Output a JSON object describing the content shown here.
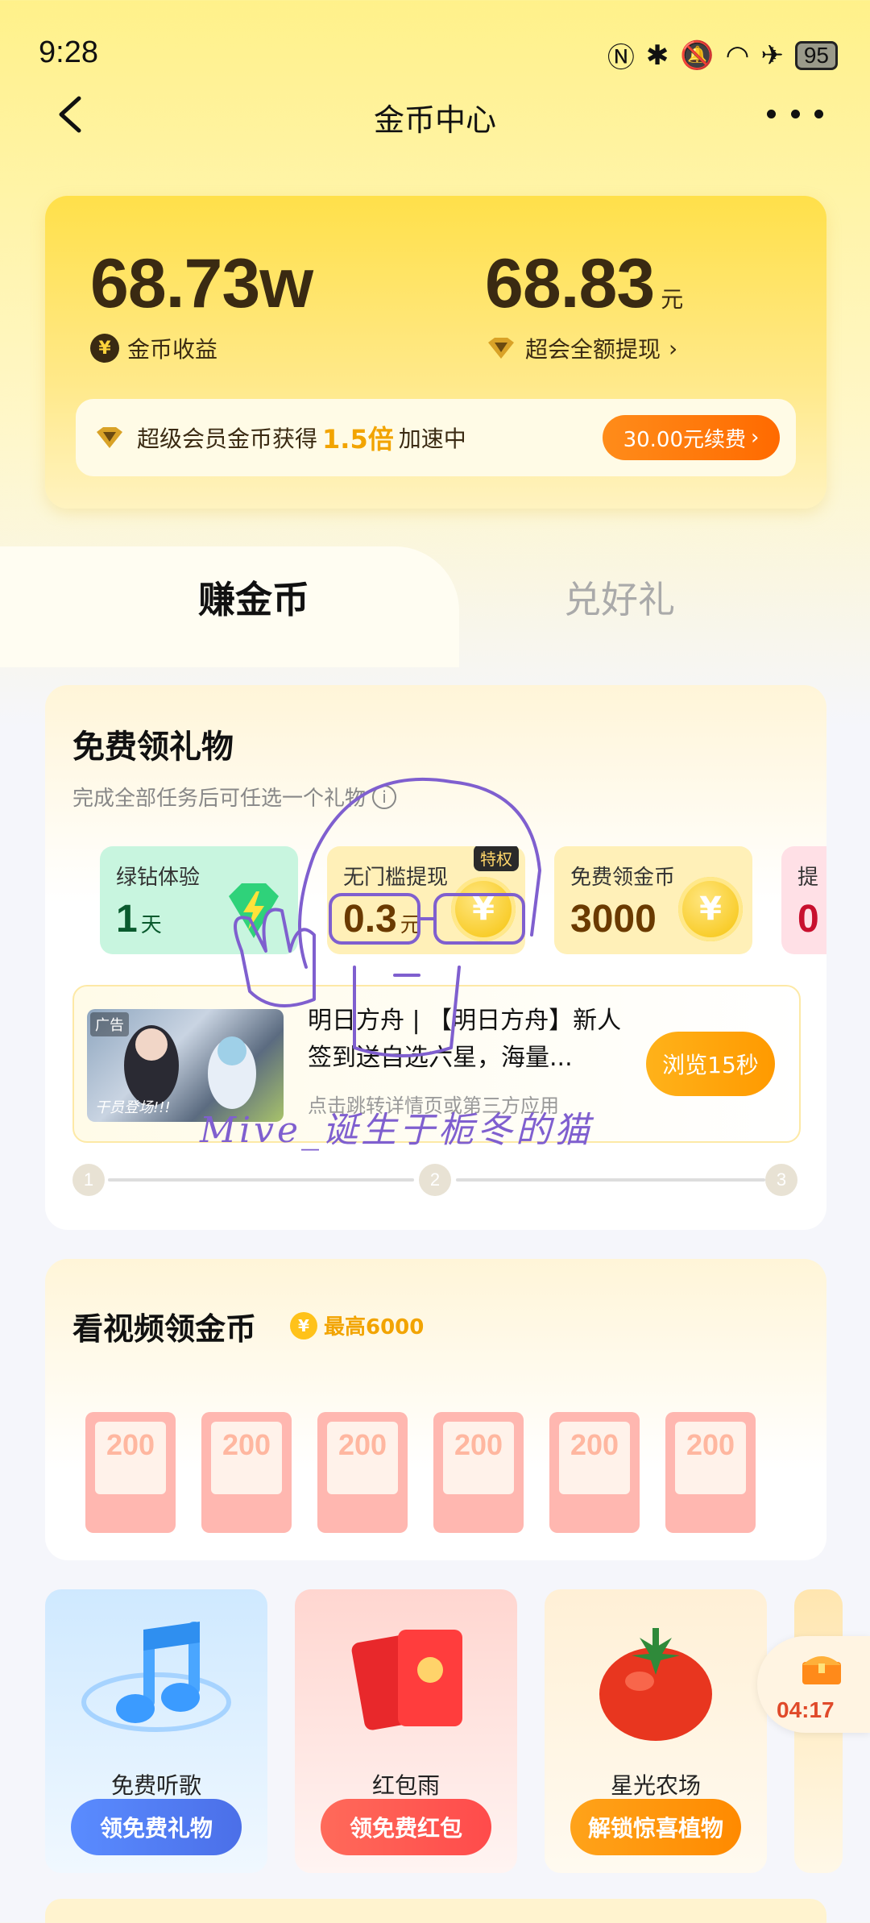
{
  "status_bar": {
    "time": "9:28",
    "battery": "95"
  },
  "nav": {
    "title": "金币中心"
  },
  "earnings": {
    "coin_value": "68.73w",
    "coin_label": "金币收益",
    "cash_value": "68.83",
    "cash_unit": "元",
    "cash_label": "超会全额提现",
    "vip_text_prefix": "超级会员金币获得",
    "vip_multiplier": "1.5倍",
    "vip_text_suffix": "加速中",
    "renew_label": "30.00元续费"
  },
  "tabs": [
    {
      "label": "赚金币"
    },
    {
      "label": "兑好礼"
    }
  ],
  "gift_section": {
    "title": "免费领礼物",
    "subtitle": "完成全部任务后可任选一个礼物",
    "tiles": [
      {
        "name": "绿钻体验",
        "value": "1",
        "unit": "天"
      },
      {
        "name": "无门槛提现",
        "value": "0.3",
        "unit": "元",
        "tag": "特权"
      },
      {
        "name": "免费领金币",
        "value": "3000",
        "unit": ""
      },
      {
        "name": "提",
        "value": "0",
        "unit": ""
      }
    ],
    "ad": {
      "badge": "广告",
      "thumb_caption": "干员登场!!!",
      "title": "明日方舟 | 【明日方舟】新人签到送自选六星，海量...",
      "subtitle": "点击跳转详情页或第三方应用",
      "button": "浏览15秒"
    },
    "steps": [
      "1",
      "2",
      "3"
    ]
  },
  "video_section": {
    "title": "看视频领金币",
    "max_label": "最高6000",
    "envelopes": [
      "200",
      "200",
      "200",
      "200",
      "200",
      "200"
    ]
  },
  "features": [
    {
      "name": "免费听歌",
      "button": "领免费礼物"
    },
    {
      "name": "红包雨",
      "button": "领免费红包"
    },
    {
      "name": "星光农场",
      "button": "解锁惊喜植物"
    }
  ],
  "timer": {
    "value": "04:17"
  },
  "watermark": {
    "text": "Mive_诞生于栀冬的猫"
  },
  "colors": {
    "accent_orange": "#ff7a00",
    "gold": "#f2a400",
    "brand_yellow": "#ffe04a"
  }
}
